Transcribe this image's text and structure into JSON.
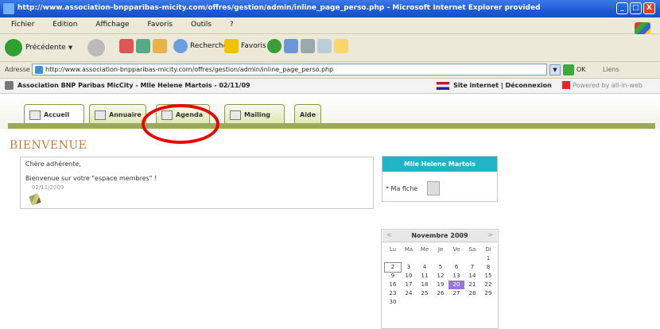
{
  "window": {
    "title": "http://www.association-bnpparibas-micity.com/offres/gestion/admin/inline_page_perso.php - Microsoft Internet Explorer provided",
    "min": "_",
    "max": "□",
    "close": "X"
  },
  "menu": [
    "Fichier",
    "Edition",
    "Affichage",
    "Favoris",
    "Outils",
    "?"
  ],
  "toolbar": {
    "back": "Précédente",
    "search": "Rechercher",
    "favorites": "Favoris"
  },
  "address": {
    "label": "Adresse",
    "url": "http://www.association-bnpparibas-micity.com/offres/gestion/admin/inline_page_perso.php",
    "go": "OK",
    "links": "Liens"
  },
  "site": {
    "breadcrumb": "Association BNP Paribas MicCity - Mlle Helene Martois - 02/11/09",
    "right_links": "Site internet | Déconnexion",
    "powered": "Powered by all-in-web"
  },
  "tabs": [
    {
      "label": "Accueil"
    },
    {
      "label": "Annuaire"
    },
    {
      "label": "Agenda"
    },
    {
      "label": "Mailing"
    },
    {
      "label": "Aide"
    }
  ],
  "content": {
    "title": "BIENVENUE",
    "greeting": "Chère adhérente,",
    "welcome": "Bienvenue sur votre \"espace membres\" !",
    "date": "02/11/2009"
  },
  "user_panel": {
    "name": "Mlle Helene Martois",
    "my_file": "Ma fiche"
  },
  "calendar": {
    "month": "Novembre 2009",
    "prev": "<",
    "next": ">",
    "weekdays": [
      "Lu",
      "Ma",
      "Me",
      "Je",
      "Ve",
      "Sa",
      "Di"
    ],
    "weeks": [
      [
        "",
        "",
        "",
        "",
        "",
        "",
        "1"
      ],
      [
        "2",
        "3",
        "4",
        "5",
        "6",
        "7",
        "8"
      ],
      [
        "9",
        "10",
        "11",
        "12",
        "13",
        "14",
        "15"
      ],
      [
        "16",
        "17",
        "18",
        "19",
        "20",
        "21",
        "22"
      ],
      [
        "23",
        "24",
        "25",
        "26",
        "27",
        "28",
        "29"
      ],
      [
        "30",
        "",
        "",
        "",
        "",
        "",
        ""
      ]
    ],
    "today": "2",
    "selected": "20"
  }
}
